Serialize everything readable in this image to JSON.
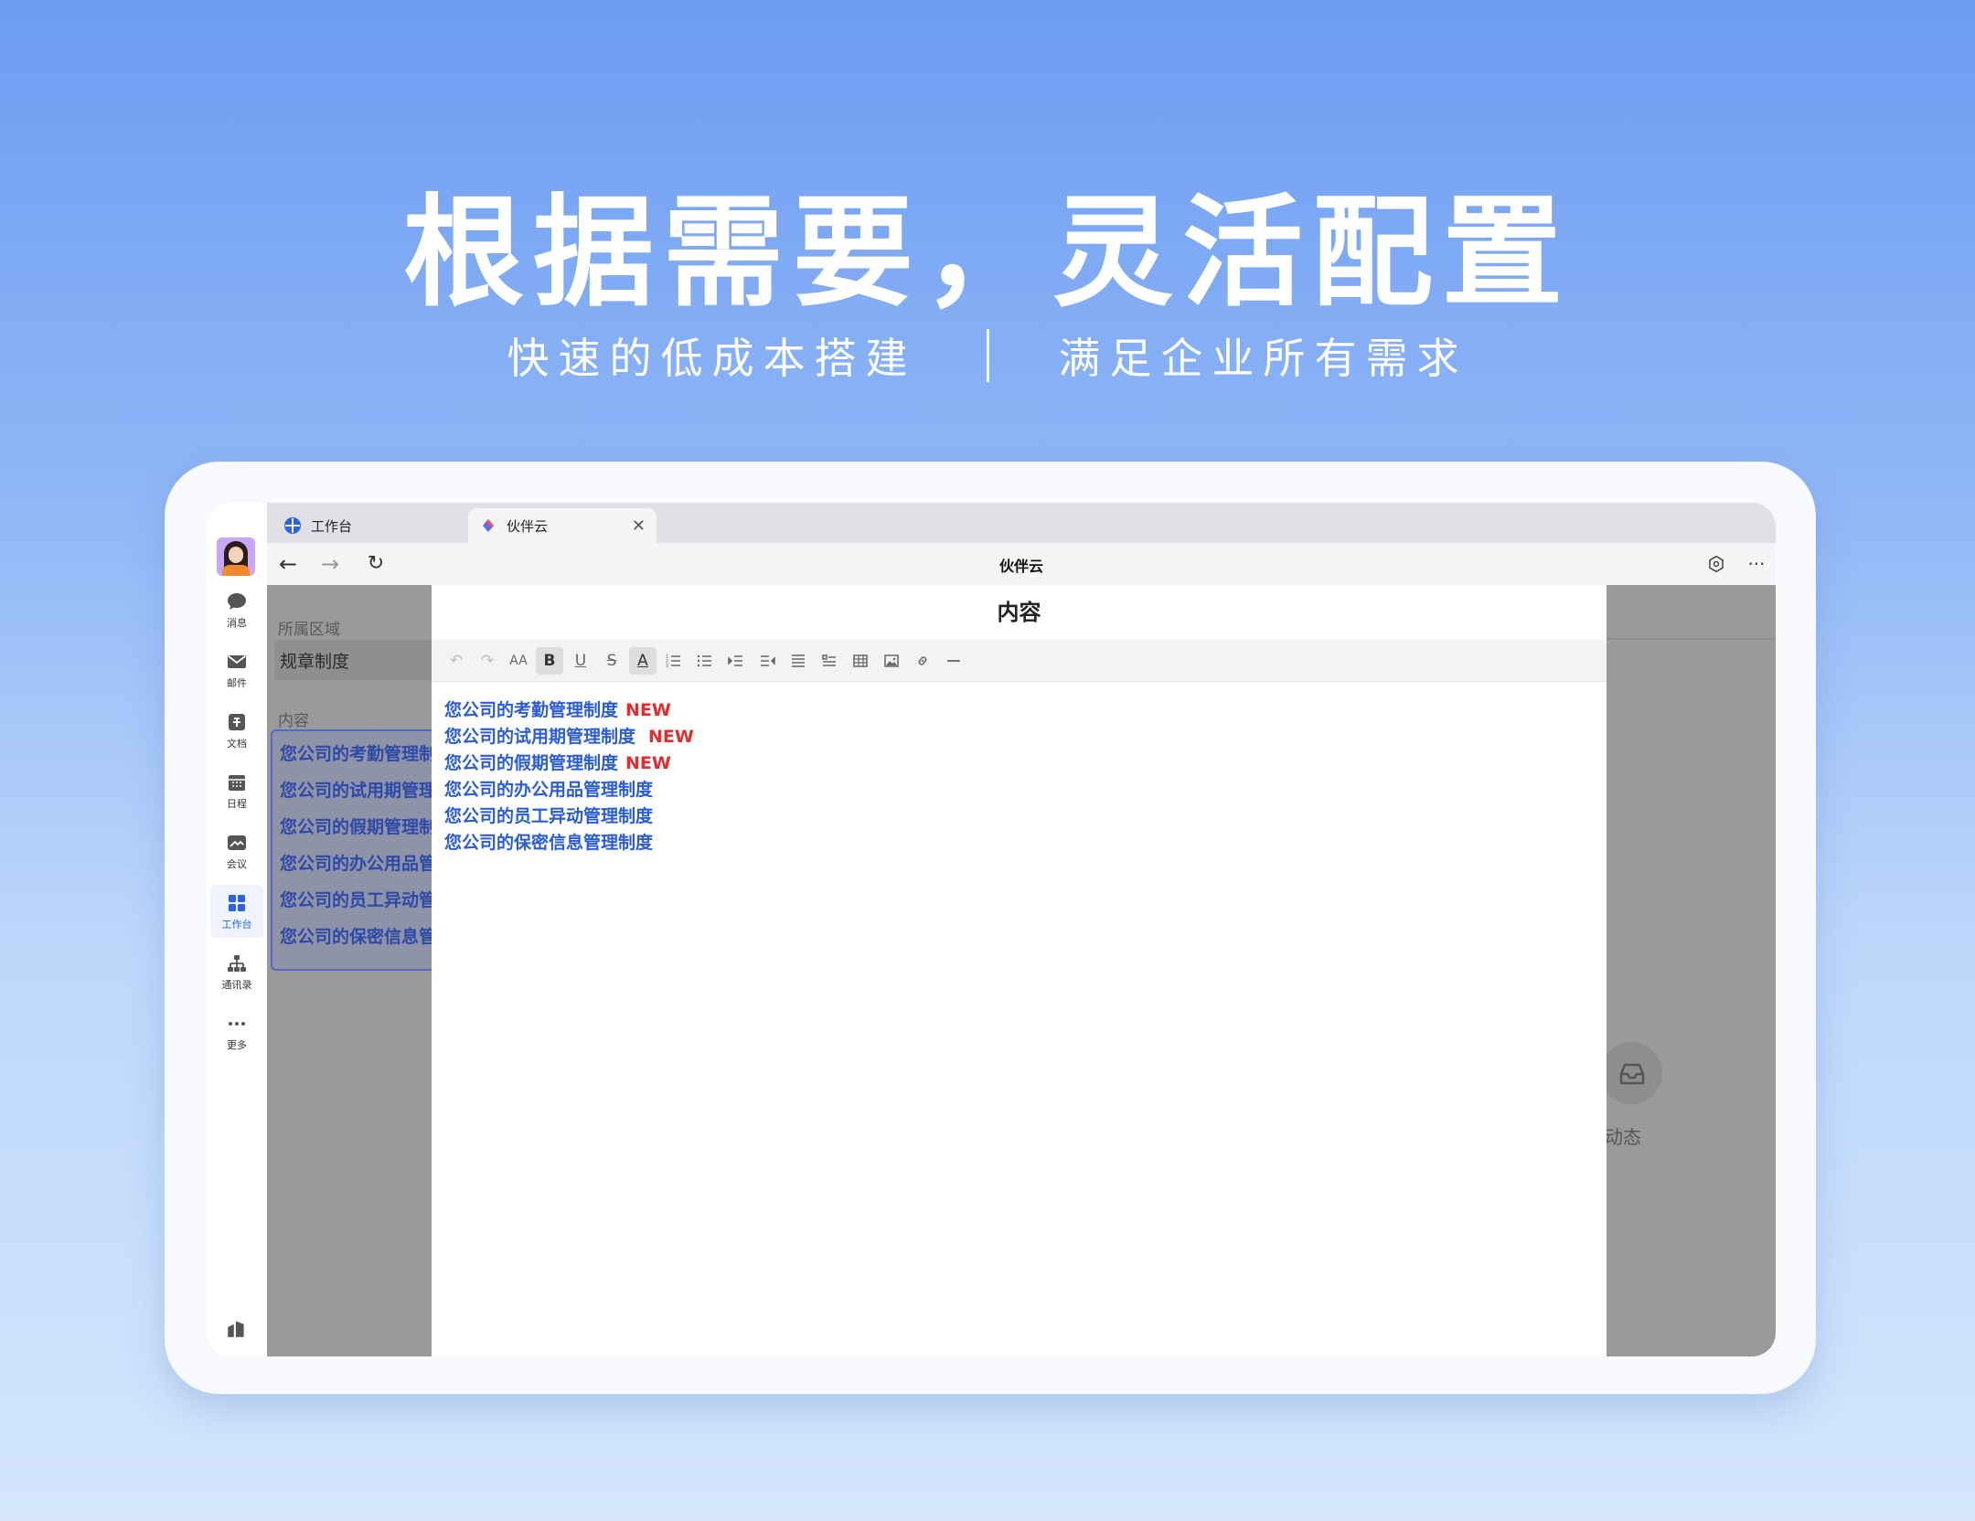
{
  "hero": {
    "title": "根据需要，灵活配置",
    "subtitle_left": "快速的低成本搭建",
    "subtitle_right": "满足企业所有需求"
  },
  "rail": {
    "items": [
      {
        "label": "消息",
        "icon": "chat-icon"
      },
      {
        "label": "邮件",
        "icon": "mail-icon"
      },
      {
        "label": "文档",
        "icon": "doc-icon"
      },
      {
        "label": "日程",
        "icon": "calendar-icon"
      },
      {
        "label": "会议",
        "icon": "meeting-icon"
      },
      {
        "label": "工作台",
        "icon": "workbench-icon",
        "active": true
      },
      {
        "label": "通讯录",
        "icon": "contacts-icon"
      },
      {
        "label": "更多",
        "icon": "more-icon"
      }
    ]
  },
  "tabs": [
    {
      "label": "工作台",
      "icon": "workbench-tab-icon"
    },
    {
      "label": "伙伴云",
      "icon": "huobanyun-logo-icon",
      "active": true
    }
  ],
  "address": {
    "title": "伙伴云"
  },
  "background_page": {
    "area_label": "所属区域",
    "area_value": "规章制度",
    "content_label": "内容",
    "list": [
      "您公司的考勤管理制",
      "您公司的试用期管理",
      "您公司的假期管理制",
      "您公司的办公用品管",
      "您公司的员工异动管",
      "您公司的保密信息管"
    ],
    "dynamic_label": "动态"
  },
  "editor": {
    "title": "内容",
    "lines": [
      {
        "text": "您公司的考勤管理制度",
        "badge": "NEW"
      },
      {
        "text": "您公司的试用期管理制度",
        "badge": "NEW"
      },
      {
        "text": "您公司的假期管理制度",
        "badge": "NEW"
      },
      {
        "text": "您公司的办公用品管理制度",
        "badge": ""
      },
      {
        "text": "您公司的员工异动管理制度",
        "badge": ""
      },
      {
        "text": "您公司的保密信息管理制度",
        "badge": ""
      }
    ],
    "toolbar": {
      "font_size": "AA",
      "bold": "B",
      "underline": "U",
      "strike": "S",
      "color": "A"
    }
  },
  "colors": {
    "accent": "#2b63e6",
    "link": "#2a5cd8",
    "new_badge": "#e52b2b"
  }
}
